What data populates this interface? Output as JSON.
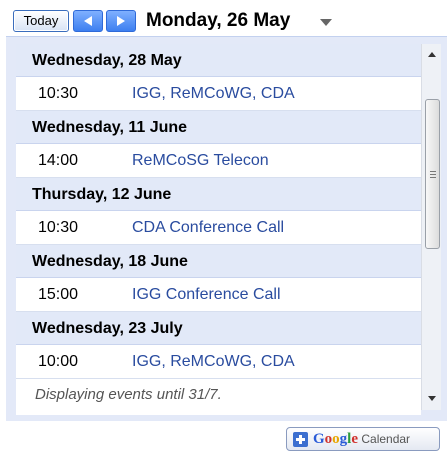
{
  "toolbar": {
    "today_label": "Today",
    "current_date": "Monday, 26 May"
  },
  "agenda": {
    "days": [
      {
        "date": "Wednesday, 28 May",
        "events": [
          {
            "time": "10:30",
            "title": "IGG, ReMCoWG, CDA"
          }
        ]
      },
      {
        "date": "Wednesday, 11 June",
        "events": [
          {
            "time": "14:00",
            "title": "ReMCoSG Telecon"
          }
        ]
      },
      {
        "date": "Thursday, 12 June",
        "events": [
          {
            "time": "10:30",
            "title": "CDA Conference Call"
          }
        ]
      },
      {
        "date": "Wednesday, 18 June",
        "events": [
          {
            "time": "15:00",
            "title": "IGG Conference Call"
          }
        ]
      },
      {
        "date": "Wednesday, 23 July",
        "events": [
          {
            "time": "10:00",
            "title": "IGG, ReMCoWG, CDA"
          }
        ]
      }
    ],
    "footer_text": "Displaying events until 31/7."
  },
  "google_calendar_button": {
    "google_letters": [
      "G",
      "o",
      "o",
      "g",
      "l",
      "e"
    ],
    "calendar_label": "Calendar"
  },
  "colors": {
    "accent_blue": "#3d7ff0",
    "event_link": "#2a4c9f",
    "day_header_bg": "#e2e9f8"
  }
}
